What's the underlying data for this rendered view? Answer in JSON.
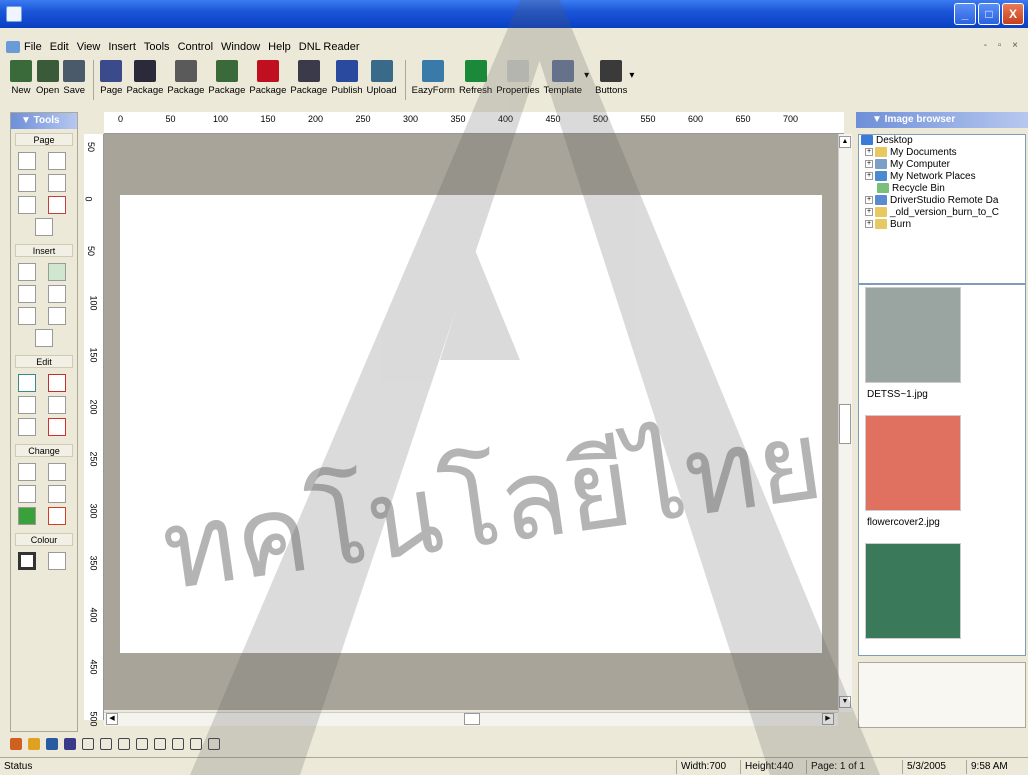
{
  "window": {
    "controls": [
      "_",
      "□",
      "X"
    ]
  },
  "menu": {
    "items": [
      "File",
      "Edit",
      "View",
      "Insert",
      "Tools",
      "Control",
      "Window",
      "Help",
      "DNL Reader"
    ],
    "mdi_controls": "- ▫ ×"
  },
  "toolbar": {
    "buttons": [
      {
        "label": "New",
        "icon": "new-icon",
        "color": "#3a6a3a"
      },
      {
        "label": "Open",
        "icon": "open-icon",
        "color": "#3a5a3a"
      },
      {
        "label": "Save",
        "icon": "save-icon",
        "color": "#4a5a6a"
      },
      {
        "label": "Page",
        "icon": "page-icon",
        "color": "#3a4a8a"
      },
      {
        "label": "Package",
        "icon": "package-icon",
        "color": "#2a2a3a"
      },
      {
        "label": "Package",
        "icon": "package-icon",
        "color": "#5a5a5a"
      },
      {
        "label": "Package",
        "icon": "package-lock-icon",
        "color": "#3a6a3a"
      },
      {
        "label": "Package",
        "icon": "package-lock-icon",
        "color": "#c01020"
      },
      {
        "label": "Package",
        "icon": "package-icon",
        "color": "#3a3a4a"
      },
      {
        "label": "Publish",
        "icon": "publish-icon",
        "color": "#2a4aa0"
      },
      {
        "label": "Upload",
        "icon": "upload-icon",
        "color": "#3a6a8a"
      },
      {
        "label": "EazyForm",
        "icon": "eazyform-icon",
        "color": "#3a7aa8"
      },
      {
        "label": "Refresh",
        "icon": "refresh-icon",
        "color": "#1a8a3a"
      },
      {
        "label": "Properties",
        "icon": "properties-icon",
        "color": "#d0d0c8"
      },
      {
        "label": "Template",
        "icon": "template-icon",
        "color": "#6a7a9a"
      },
      {
        "label": "Buttons",
        "icon": "buttons-icon",
        "color": "#3a3a3a"
      }
    ]
  },
  "tools": {
    "title": "▼ Tools",
    "sections": [
      "Page",
      "Insert",
      "Edit",
      "Change",
      "Colour"
    ]
  },
  "ruler": {
    "top": [
      "0",
      "50",
      "100",
      "150",
      "200",
      "250",
      "300",
      "350",
      "400",
      "450",
      "500",
      "550",
      "600",
      "650",
      "700"
    ],
    "left": [
      "50",
      "0",
      "50",
      "100",
      "150",
      "200",
      "250",
      "300",
      "350",
      "400",
      "450",
      "500"
    ]
  },
  "image_browser": {
    "title": "▼ Image browser",
    "tree": [
      {
        "label": "Desktop",
        "expander": "",
        "color": "#3a7ad8"
      },
      {
        "label": "My Documents",
        "expander": "+",
        "color": "#e8c860"
      },
      {
        "label": "My Computer",
        "expander": "+",
        "color": "#7aa0c8"
      },
      {
        "label": "My Network Places",
        "expander": "+",
        "color": "#4a8ad0"
      },
      {
        "label": "Recycle Bin",
        "expander": "",
        "color": "#7ac07a"
      },
      {
        "label": "DriverStudio Remote Da",
        "expander": "+",
        "color": "#5a8ad0"
      },
      {
        "label": "_old_version_burn_to_C",
        "expander": "+",
        "color": "#e8c860"
      },
      {
        "label": "Burn",
        "expander": "+",
        "color": "#e8c860"
      }
    ],
    "thumbnails": [
      {
        "caption": "DETSS~1.jpg",
        "color": "#9aa4a0"
      },
      {
        "caption": "flowercover2.jpg",
        "color": "#e07060"
      },
      {
        "caption": "",
        "color": "#3a7a5a"
      }
    ]
  },
  "status": {
    "label": "Status",
    "width": "Width:700",
    "height": "Height:440",
    "page": "Page: 1 of 1",
    "date": "5/3/2005",
    "time": "9:58 AM"
  },
  "watermark": {
    "text": "ทคโนโลยีไทย",
    "color": "#5a5a5a"
  }
}
